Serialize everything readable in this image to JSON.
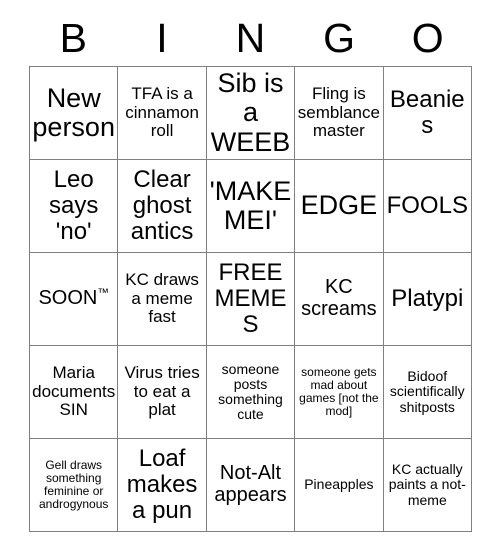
{
  "card": {
    "title": "BINGO",
    "header": [
      "B",
      "I",
      "N",
      "G",
      "O"
    ],
    "grid_color": "#808080",
    "text_color": "#000000",
    "background_color": "#ffffff",
    "rows": [
      [
        {
          "text": "New person",
          "size": "s1"
        },
        {
          "text": "TFA is a cinnamon roll",
          "size": "s4"
        },
        {
          "text": "Sib is a WEEB",
          "size": "s1"
        },
        {
          "text": "Fling is semblance master",
          "size": "s4"
        },
        {
          "text": "Beanies",
          "size": "s2"
        }
      ],
      [
        {
          "text": "Leo says 'no'",
          "size": "s2"
        },
        {
          "text": "Clear ghost antics",
          "size": "s2"
        },
        {
          "text": "'MAKE MEI'",
          "size": "s1"
        },
        {
          "text": "EDGE",
          "size": "s1"
        },
        {
          "text": "FOOLS",
          "size": "s2"
        }
      ],
      [
        {
          "text": "SOON",
          "suffix": "TM",
          "size": "s3"
        },
        {
          "text": "KC draws a meme fast",
          "size": "s4"
        },
        {
          "text": "FREE MEMES",
          "size": "s2"
        },
        {
          "text": "KC screams",
          "size": "s3"
        },
        {
          "text": "Platypi",
          "size": "s2"
        }
      ],
      [
        {
          "text": "Maria documents SIN",
          "size": "s4"
        },
        {
          "text": "Virus tries to eat a plat",
          "size": "s4"
        },
        {
          "text": "someone posts something cute",
          "size": "s5"
        },
        {
          "text": "someone gets mad about games [not the mod]",
          "size": "s6"
        },
        {
          "text": "Bidoof scientifically shitposts",
          "size": "s5"
        }
      ],
      [
        {
          "text": "Gell draws something feminine or androgynous",
          "size": "s6"
        },
        {
          "text": "Loaf makes a pun",
          "size": "s2"
        },
        {
          "text": "Not-Alt appears",
          "size": "s3"
        },
        {
          "text": "Pineapples",
          "size": "s5"
        },
        {
          "text": "KC actually paints a not-meme",
          "size": "s5"
        }
      ]
    ]
  }
}
